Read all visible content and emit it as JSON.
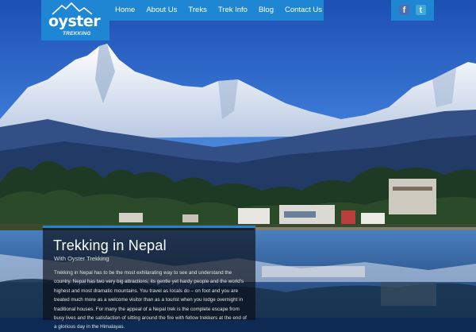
{
  "logo": {
    "brand": "oyster",
    "sub": "TREKKING",
    "icon": "mountain-logo-icon"
  },
  "nav": {
    "items": [
      "Home",
      "About Us",
      "Treks",
      "Trek Info",
      "Blog",
      "Contact Us"
    ]
  },
  "social": {
    "facebook": "f",
    "twitter": "t",
    "facebook_icon": "facebook-icon",
    "twitter_icon": "twitter-icon"
  },
  "panel": {
    "title": "Trekking in Nepal",
    "subtitle": "With Oyster Trekking",
    "body": "Trekking in Nepal has to be the most exhilarating way to see and understand the country. Nepal has two very big attractions; its gentle yet hardy people and the world's highest and most dramatic mountains. You travel as locals do – on foot and you are treated much more as a welcome visitor than as a tourist when you lodge overnight in traditional houses. For many the appeal of a Nepal trek is the complete escape from busy lives and the satisfaction of sitting around the fire with fellow trekkers at the end of a glorious day in the Himalayas."
  },
  "colors": {
    "accent": "#1f86d4",
    "sky_top": "#1d4fb3",
    "panel_bg": "#0a0e16"
  }
}
